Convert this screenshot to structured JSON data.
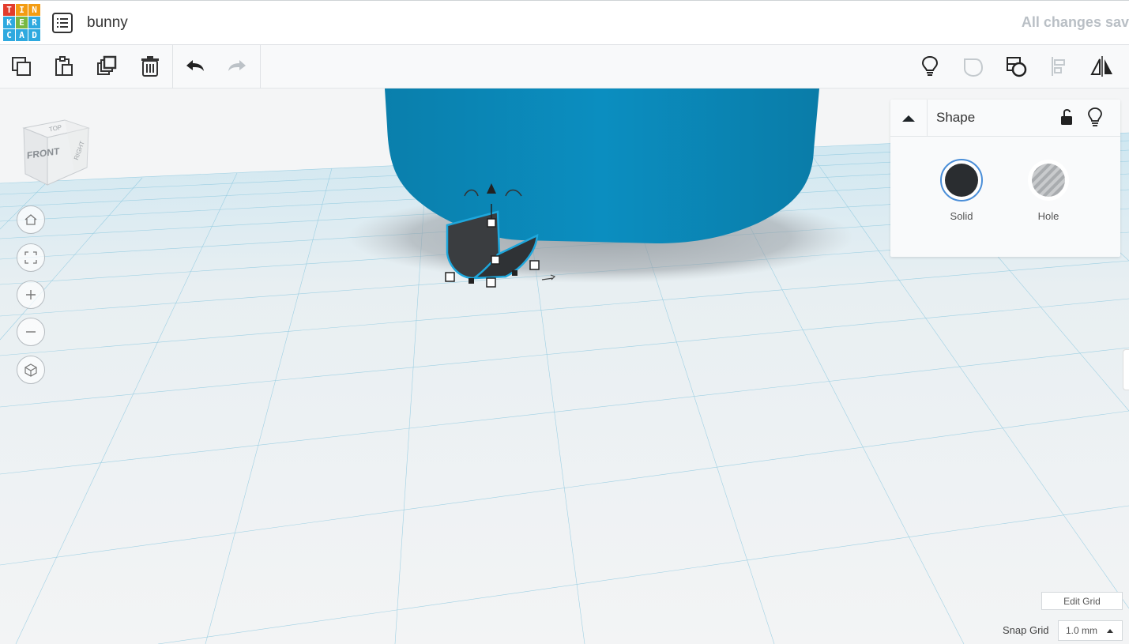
{
  "app": {
    "logo_letters": [
      "T",
      "I",
      "N",
      "K",
      "E",
      "R",
      "C",
      "A",
      "D"
    ],
    "logo_colors": [
      "#e33c2c",
      "#f39c12",
      "#f39c12",
      "#2ea9df",
      "#77b843",
      "#2ea9df",
      "#2ea9df",
      "#2ea9df",
      "#2ea9df"
    ],
    "project_title": "bunny",
    "save_status": "All changes sav"
  },
  "toolbar": {
    "copy_icon": "copy-icon",
    "paste_icon": "paste-icon",
    "duplicate_icon": "duplicate-icon",
    "delete_icon": "trash-icon",
    "undo_icon": "undo-icon",
    "redo_icon": "redo-icon",
    "show_all_icon": "lightbulb-icon",
    "group_icon": "group-icon",
    "ungroup_icon": "ungroup-icon",
    "align_icon": "align-icon",
    "mirror_icon": "mirror-icon"
  },
  "viewcube": {
    "front": "FRONT",
    "top": "TOP",
    "right": "RIGHT"
  },
  "nav_buttons": [
    "home-view-icon",
    "fit-view-icon",
    "zoom-in-icon",
    "zoom-out-icon",
    "perspective-icon"
  ],
  "shape_panel": {
    "title": "Shape",
    "options": [
      {
        "label": "Solid",
        "color": "#2a2d30",
        "selected": true
      },
      {
        "label": "Hole",
        "color": "#b6b9bc",
        "selected": false
      }
    ]
  },
  "grid": {
    "edit_grid_label": "Edit Grid",
    "snap_grid_label": "Snap Grid",
    "snap_grid_value": "1.0 mm"
  },
  "colors": {
    "accent": "#1c9ed0",
    "shape_blue": "#0a87b4",
    "selected_shape": "#3a3d40"
  }
}
